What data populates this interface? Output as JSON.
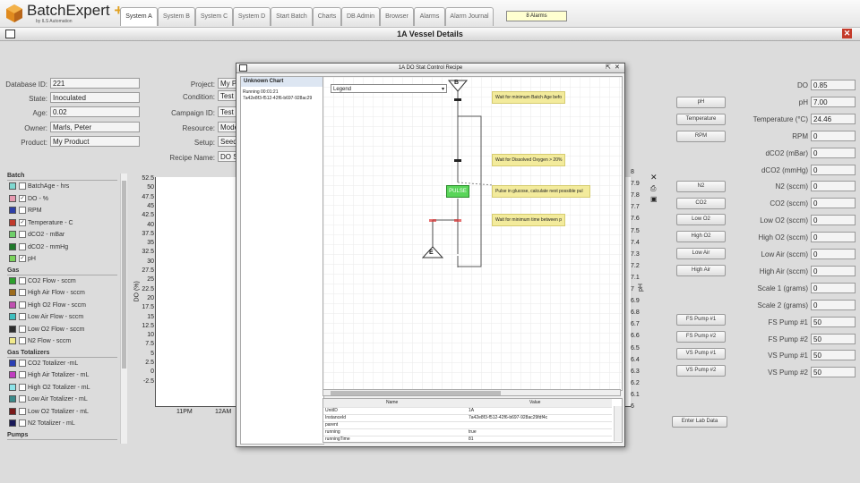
{
  "app": {
    "name": "BatchExpert",
    "plus": "+",
    "subtitle": "by ILS Automation"
  },
  "tabs": [
    {
      "label": "System A",
      "active": true
    },
    {
      "label": "System B"
    },
    {
      "label": "System C"
    },
    {
      "label": "System D"
    },
    {
      "label": "Start Batch"
    },
    {
      "label": "Charts"
    },
    {
      "label": "DB Admin"
    },
    {
      "label": "Browser"
    },
    {
      "label": "Alarms"
    },
    {
      "label": "Alarm Journal"
    }
  ],
  "alarm_badge": "8 Alarms",
  "window": {
    "title": "1A Vessel Details",
    "close": "✕"
  },
  "batch_info": {
    "database_id": {
      "label": "Database ID:",
      "value": "221"
    },
    "state": {
      "label": "State:",
      "value": "Inoculated"
    },
    "age": {
      "label": "Age:",
      "value": "0.02"
    },
    "owner": {
      "label": "Owner:",
      "value": "Marls, Peter"
    },
    "product": {
      "label": "Product:",
      "value": "My Product"
    }
  },
  "project_info": {
    "project": {
      "label": "Project:",
      "value": "My P"
    },
    "condition": {
      "label": "Condition:",
      "value": "Test"
    },
    "campaign": {
      "label": "Campaign ID:",
      "value": "Test"
    },
    "resource": {
      "label": "Resource:",
      "value": "Mode"
    },
    "setup": {
      "label": "Setup:",
      "value": "Seed"
    },
    "recipe": {
      "label": "Recipe Name:",
      "value": "DO S"
    }
  },
  "legend": {
    "groups": [
      {
        "title": "Batch",
        "items": [
          {
            "label": "BatchAge - hrs",
            "color": "#7fd8d0",
            "checked": false
          },
          {
            "label": "DO - %",
            "color": "#e79ab0",
            "checked": true
          },
          {
            "label": "RPM",
            "color": "#2e3fa8",
            "checked": false
          },
          {
            "label": "Temperature - C",
            "color": "#c0392b",
            "checked": true
          },
          {
            "label": "dCO2 - mBar",
            "color": "#6fcf6a",
            "checked": false
          },
          {
            "label": "dCO2 - mmHg",
            "color": "#1e7a2a",
            "checked": false
          },
          {
            "label": "pH",
            "color": "#7bd35c",
            "checked": true
          }
        ]
      },
      {
        "title": "Gas",
        "items": [
          {
            "label": "CO2 Flow - sccm",
            "color": "#2ca02c",
            "checked": false
          },
          {
            "label": "High Air Flow - sccm",
            "color": "#9c6b1c",
            "checked": false
          },
          {
            "label": "High O2 Flow - sccm",
            "color": "#c04fb0",
            "checked": false
          },
          {
            "label": "Low Air Flow - sccm",
            "color": "#3fbfbf",
            "checked": false
          },
          {
            "label": "Low O2 Flow - sccm",
            "color": "#2d2d2d",
            "checked": false
          },
          {
            "label": "N2 Flow - sccm",
            "color": "#f1ea8c",
            "checked": false
          }
        ]
      },
      {
        "title": "Gas Totalizers",
        "items": [
          {
            "label": "CO2 Totalizer -mL",
            "color": "#2b3fb5",
            "checked": false
          },
          {
            "label": "High Air Totalizer - mL",
            "color": "#c03cbf",
            "checked": false
          },
          {
            "label": "High O2 Totalizer - mL",
            "color": "#8de3e8",
            "checked": false
          },
          {
            "label": "Low Air Totalizer - mL",
            "color": "#3a8a8a",
            "checked": false
          },
          {
            "label": "Low O2 Totalizer - mL",
            "color": "#7a1a1a",
            "checked": false
          },
          {
            "label": "N2 Totalizer - mL",
            "color": "#1a1a5a",
            "checked": false
          }
        ]
      },
      {
        "title": "Pumps",
        "items": []
      }
    ]
  },
  "chart": {
    "ylabel": "DO (%)",
    "left_ticks": [
      "52.5",
      "50",
      "47.5",
      "45",
      "42.5",
      "40",
      "37.5",
      "35",
      "32.5",
      "30",
      "27.5",
      "25",
      "22.5",
      "20",
      "17.5",
      "15",
      "12.5",
      "10",
      "7.5",
      "5",
      "2.5",
      "0",
      "-2.5"
    ],
    "right_ticks": [
      "8",
      "7.9",
      "7.8",
      "7.7",
      "7.6",
      "7.5",
      "7.4",
      "7.3",
      "7.2",
      "7.1",
      "7",
      "6.9",
      "6.8",
      "6.7",
      "6.6",
      "6.5",
      "6.4",
      "6.3",
      "6.2",
      "6.1",
      "6"
    ],
    "right_label": "pH",
    "x_ticks": [
      "11PM",
      "12AM"
    ]
  },
  "popup": {
    "title": "1A DO Stat Control Recipe",
    "side": {
      "title": "Unknown Chart",
      "running": "Running 00:01:21",
      "instance": "7a42e8f3-f512-42f6-b697-928ac29"
    },
    "legend_select": "Legend",
    "nodes": {
      "begin": "B",
      "end": "E",
      "pulse": "PULSE"
    },
    "notes": [
      "Wait for minimum Batch Age befo",
      "Wait for Dissolved Oxygen > 20%",
      "Pulse in glucose, calculate next possible pul",
      "Wait for minimum time between p"
    ],
    "table": {
      "headers": [
        "Name",
        "Value"
      ],
      "rows": [
        [
          "UnitID",
          "1A"
        ],
        [
          "InstanceId",
          "7a42e8f3-f512-42f6-b697-928ac29fdf4c"
        ],
        [
          "parent",
          ""
        ],
        [
          "running",
          "true"
        ],
        [
          "runningTime",
          "81"
        ]
      ]
    }
  },
  "buttons": [
    "pH",
    "Temperature",
    "RPM",
    "N2",
    "CO2",
    "Low O2",
    "High O2",
    "Low Air",
    "High Air",
    "FS Pump #1",
    "FS Pump #2",
    "VS Pump #1",
    "VS Pump #2",
    "Enter Lab Data"
  ],
  "readings": [
    {
      "label": "DO",
      "value": "0.85"
    },
    {
      "label": "pH",
      "value": "7.00"
    },
    {
      "label": "Temperature (°C)",
      "value": "24.46"
    },
    {
      "label": "RPM",
      "value": "0"
    },
    {
      "label": "dCO2 (mBar)",
      "value": "0"
    },
    {
      "label": "dCO2 (mmHg)",
      "value": "0"
    },
    {
      "label": "N2 (sccm)",
      "value": "0"
    },
    {
      "label": "CO2 (sccm)",
      "value": "0"
    },
    {
      "label": "Low O2 (sccm)",
      "value": "0"
    },
    {
      "label": "High O2 (sccm)",
      "value": "0"
    },
    {
      "label": "Low Air (sccm)",
      "value": "0"
    },
    {
      "label": "High Air (sccm)",
      "value": "0"
    },
    {
      "label": "Scale 1 (grams)",
      "value": "0"
    },
    {
      "label": "Scale 2 (grams)",
      "value": "0"
    },
    {
      "label": "FS Pump #1",
      "value": "50"
    },
    {
      "label": "FS Pump #2",
      "value": "50"
    },
    {
      "label": "VS Pump #1",
      "value": "50"
    },
    {
      "label": "VS Pump #2",
      "value": "50"
    }
  ]
}
